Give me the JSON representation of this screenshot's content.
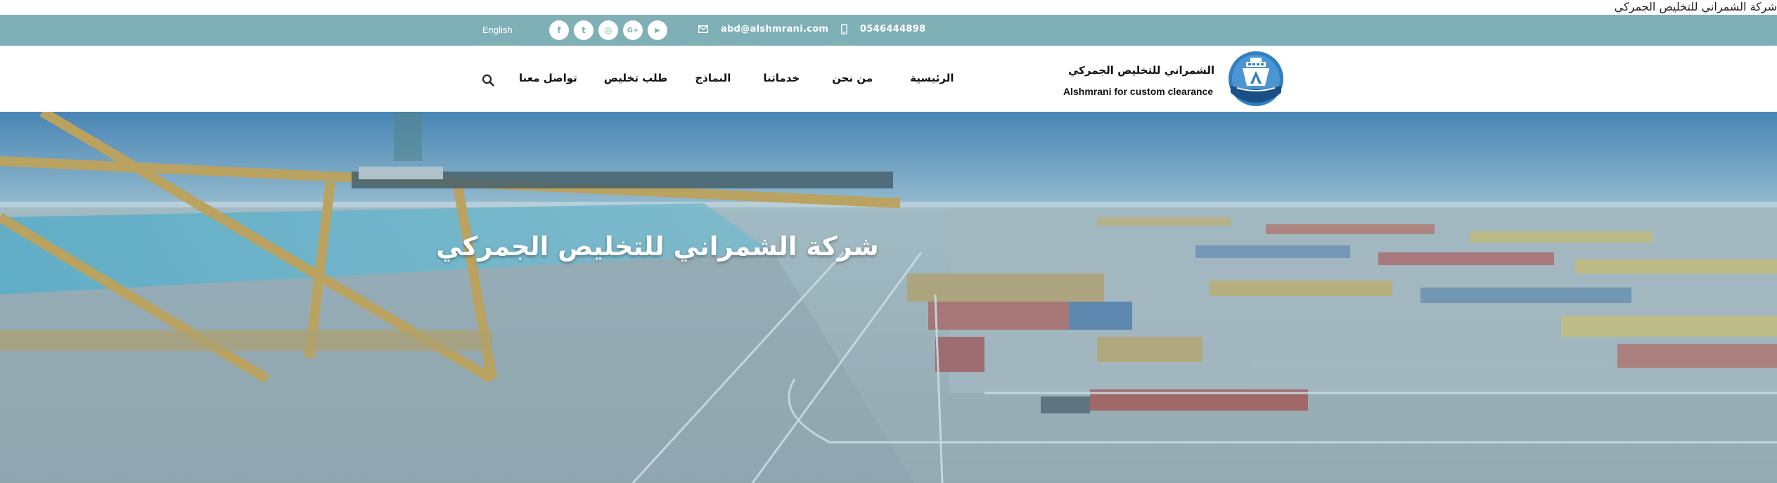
{
  "page": {
    "title": "شركة الشمراني للتخليص الجمركي"
  },
  "topbar": {
    "language": "English",
    "social_icons": [
      "facebook-icon",
      "twitter-icon",
      "instagram-icon",
      "google-plus-icon",
      "youtube-icon"
    ],
    "social_glyphs": [
      "f",
      "t",
      "◎",
      "G+",
      "▶"
    ],
    "email": "abd@alshmrani.com",
    "phone": "0546444898",
    "background": "#7fb0b6"
  },
  "brand": {
    "name_ar": "الشمراني للتخليص الجمركي",
    "name_en": "Alshmrani for custom clearance",
    "logo_color": "#2f7fc1"
  },
  "nav": {
    "items": [
      "الرئيسية",
      "من نحن",
      "خدماتنا",
      "النماذج",
      "طلب تخليص",
      "تواصل معنا"
    ],
    "search_icon": "search-icon"
  },
  "hero": {
    "title": "شركة الشمراني للتخليص الجمركي"
  }
}
